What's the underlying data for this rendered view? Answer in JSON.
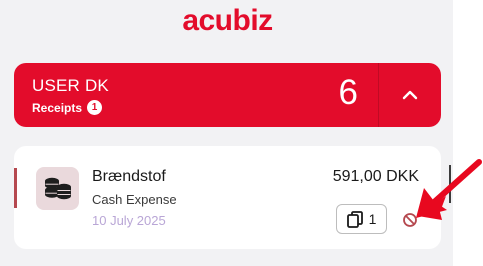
{
  "app": {
    "logo_text": "acubiz"
  },
  "colors": {
    "brand_red": "#e30c2b",
    "date_lilac": "#b9a6d6",
    "status_bar": "#b5484f",
    "annotation_red": "#e8081f"
  },
  "user_card": {
    "name": "USER DK",
    "receipts_label": "Receipts",
    "receipts_badge": "1",
    "count": "6",
    "collapse_icon": "chevron-up-icon"
  },
  "receipt": {
    "icon": "coins-stack-icon",
    "title": "Brændstof",
    "type": "Cash Expense",
    "date": "10 July 2025",
    "amount": "591,00 DKK",
    "attachments_count": "1",
    "attachments_icon": "copy-icon",
    "status_icon": "prohibited-icon"
  },
  "annotation": {
    "icon": "red-arrow-icon"
  }
}
